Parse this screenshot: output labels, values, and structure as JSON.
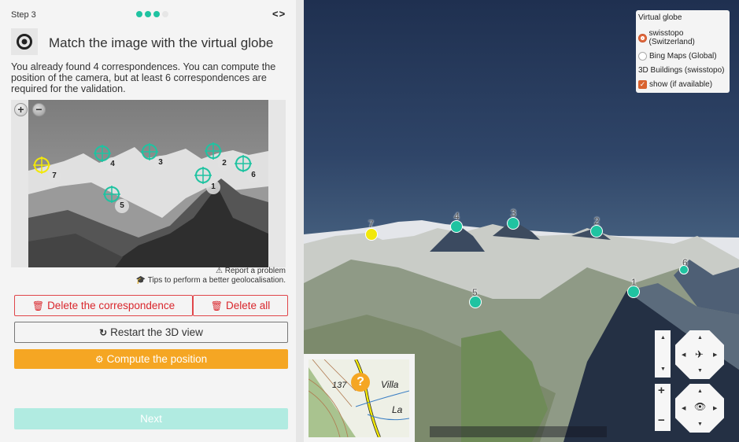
{
  "panel": {
    "step_label": "Step 3",
    "progress": {
      "completed_steps": 3,
      "total_steps": 4
    },
    "nav_arrows": "<>",
    "title_icon": "target-icon",
    "title": "Match the image with the virtual globe",
    "description": "You already found 4 correspondences. You can compute the position of the camera, but at least 6 correspondences are required for the validation.",
    "image_controls": {
      "zoom_in": "+",
      "zoom_out": "−"
    },
    "image_markers": [
      {
        "id": "1",
        "color": "#1fc3a1"
      },
      {
        "id": "2",
        "color": "#1fc3a1"
      },
      {
        "id": "3",
        "color": "#1fc3a1"
      },
      {
        "id": "4",
        "color": "#1fc3a1"
      },
      {
        "id": "5",
        "color": "#1fc3a1"
      },
      {
        "id": "6",
        "color": "#1fc3a1"
      },
      {
        "id": "7",
        "color": "#f2e80a"
      }
    ],
    "report_link": "Report a problem",
    "tips_link": "Tips to perform a better geolocalisation.",
    "buttons": {
      "delete_correspondence": "Delete the correspondence",
      "delete_all": "Delete all",
      "restart": "Restart the 3D view",
      "compute": "Compute the position",
      "next": "Next"
    }
  },
  "globe": {
    "layers": {
      "heading": "Virtual globe",
      "options": [
        {
          "label": "swisstopo (Switzerland)",
          "selected": true
        },
        {
          "label": "Bing Maps (Global)",
          "selected": false
        }
      ],
      "buildings_heading": "3D Buildings (swisstopo)",
      "buildings_option": {
        "label": "show (if available)",
        "checked": true
      }
    },
    "markers": [
      {
        "id": "7",
        "color": "#f2e80a"
      },
      {
        "id": "4",
        "color": "#1fc3a1"
      },
      {
        "id": "3",
        "color": "#1fc3a1"
      },
      {
        "id": "2",
        "color": "#1fc3a1"
      },
      {
        "id": "5",
        "color": "#1fc3a1"
      },
      {
        "id": "1",
        "color": "#1fc3a1"
      },
      {
        "id": "6",
        "color": "#1fc3a1"
      }
    ],
    "minimap": {
      "label_137": "137",
      "label_villa": "Villa",
      "label_la": "La",
      "pin": "?"
    },
    "controls": {
      "zoom_in": "+",
      "zoom_out": "−"
    }
  },
  "colors": {
    "accent": "#1fc3a1",
    "danger": "#d9262c",
    "warning": "#f5a623",
    "next_disabled": "#b1ebe1"
  }
}
